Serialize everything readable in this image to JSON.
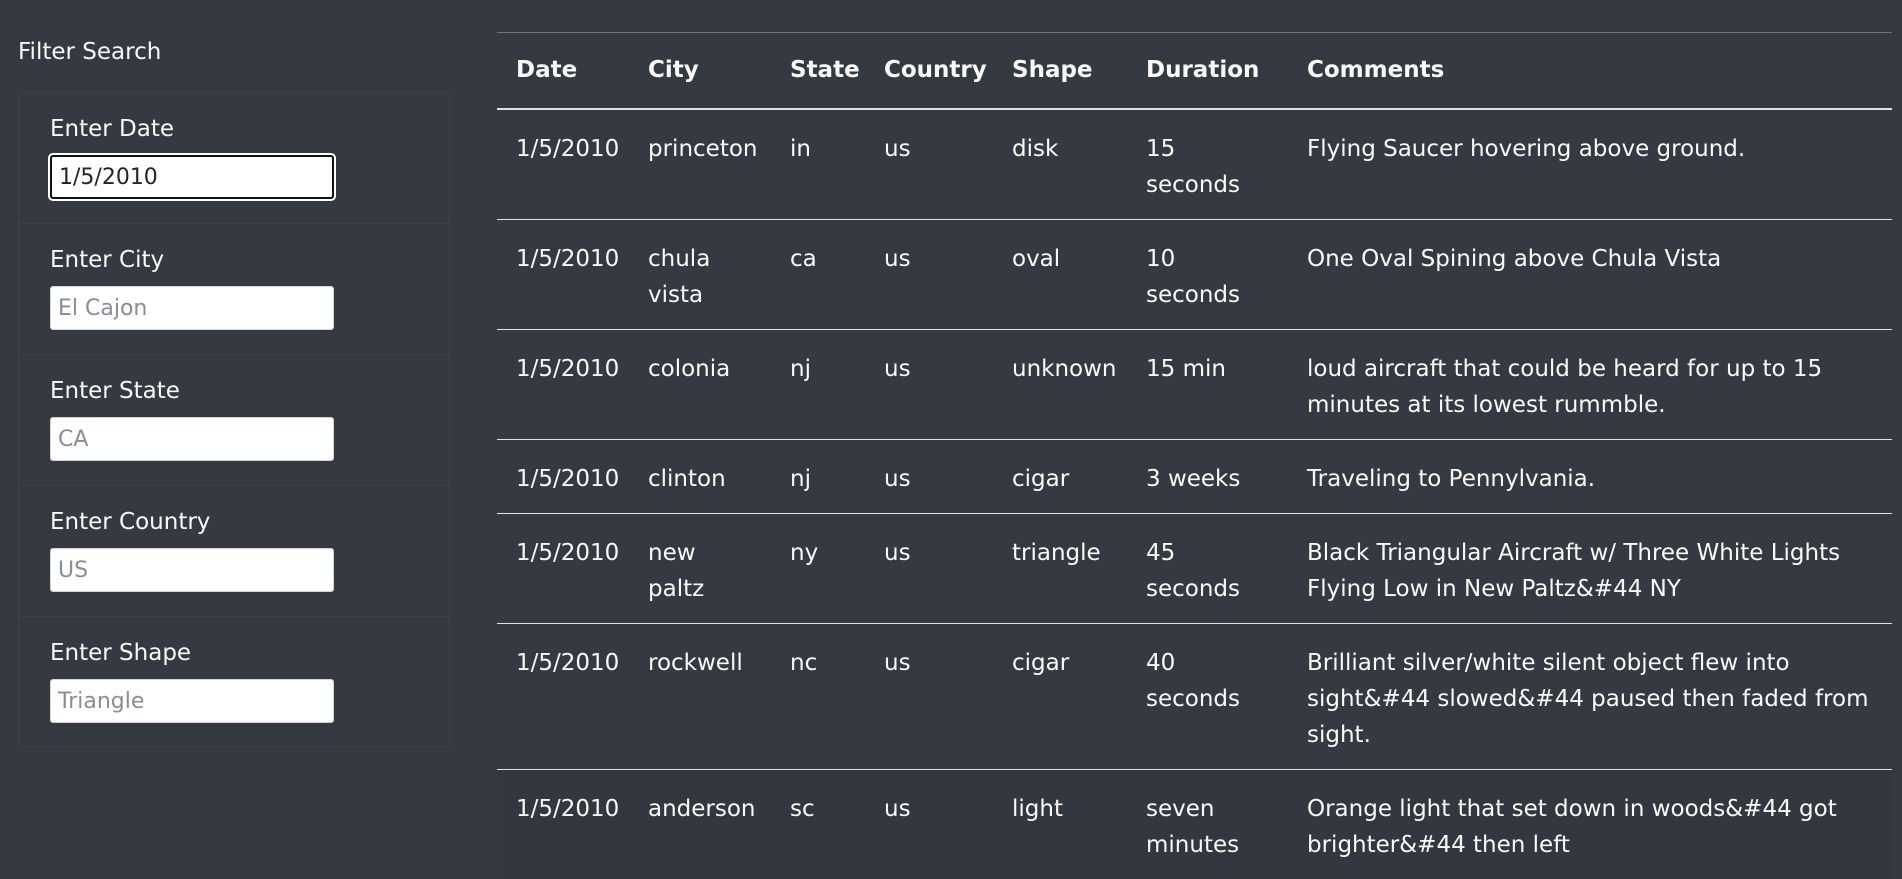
{
  "filter": {
    "title": "Filter Search",
    "fields": [
      {
        "label": "Enter Date",
        "value": "1/5/2010",
        "placeholder": ""
      },
      {
        "label": "Enter City",
        "value": "",
        "placeholder": "El Cajon"
      },
      {
        "label": "Enter State",
        "value": "",
        "placeholder": "CA"
      },
      {
        "label": "Enter Country",
        "value": "",
        "placeholder": "US"
      },
      {
        "label": "Enter Shape",
        "value": "",
        "placeholder": "Triangle"
      }
    ]
  },
  "table": {
    "headers": [
      "Date",
      "City",
      "State",
      "Country",
      "Shape",
      "Duration",
      "Comments"
    ],
    "rows": [
      [
        "1/5/2010",
        "princeton",
        "in",
        "us",
        "disk",
        "15 seconds",
        "Flying Saucer hovering above ground."
      ],
      [
        "1/5/2010",
        "chula vista",
        "ca",
        "us",
        "oval",
        "10 seconds",
        "One Oval Spining above Chula Vista"
      ],
      [
        "1/5/2010",
        "colonia",
        "nj",
        "us",
        "unknown",
        "15 min",
        "loud aircraft that could be heard for up to 15 minutes at its lowest rummble."
      ],
      [
        "1/5/2010",
        "clinton",
        "nj",
        "us",
        "cigar",
        "3 weeks",
        "Traveling to Pennylvania."
      ],
      [
        "1/5/2010",
        "new paltz",
        "ny",
        "us",
        "triangle",
        "45 seconds",
        "Black Triangular Aircraft w/ Three White Lights Flying Low in New Paltz&#44 NY"
      ],
      [
        "1/5/2010",
        "rockwell",
        "nc",
        "us",
        "cigar",
        "40 seconds",
        "Brilliant silver/white silent object flew into sight&#44 slowed&#44 paused then faded from sight."
      ],
      [
        "1/5/2010",
        "anderson",
        "sc",
        "us",
        "light",
        "seven minutes",
        "Orange light that set down in woods&#44 got brighter&#44 then left"
      ]
    ]
  }
}
